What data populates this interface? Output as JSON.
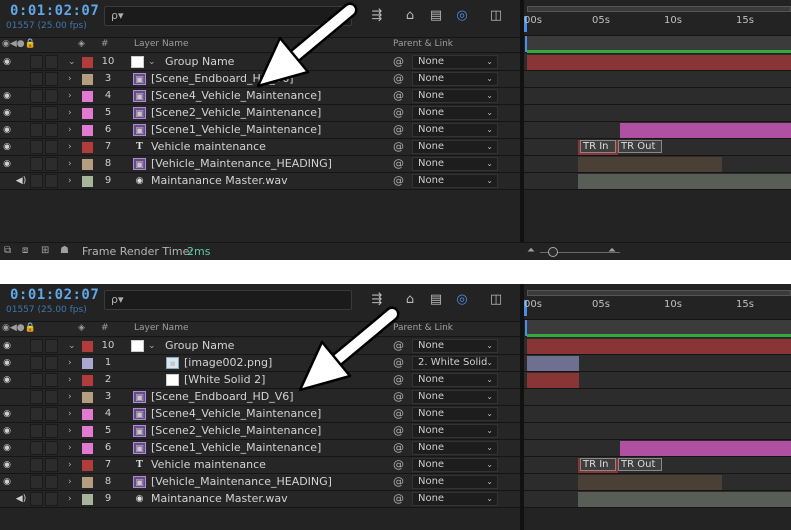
{
  "colors": {
    "accent": "#4a8ee6",
    "timecode": "#5fa7e8",
    "render_time": "#5cc9a7",
    "label_red": "#b03c3c",
    "label_tan": "#b39f7f",
    "label_pink": "#e27ad2",
    "label_sage": "#a7b59b",
    "label_lavender": "#a8a8d2",
    "bar_group": "#8a3535",
    "bar_pink": "#b050a3",
    "bar_purple": "#6f6f8f"
  },
  "panels": [
    {
      "timecode": "0:01:02:07",
      "fps": "01557 (25.00 fps)",
      "search_icon": "ρ▾",
      "header": {
        "layer_name": "Layer Name",
        "parent_link": "Parent & Link",
        "num": "#"
      },
      "ruler": [
        "00s",
        "05s",
        "10s",
        "15s"
      ],
      "layers": [
        {
          "vis": "◉",
          "aud": "",
          "num": "10",
          "label_color": "#b03c3c",
          "icon": "solid",
          "name": "Group Name",
          "twirl": "⌄",
          "parent": "None"
        },
        {
          "vis": "",
          "aud": "",
          "num": "3",
          "label_color": "#b39f7f",
          "icon": "comp",
          "name": "[Scene_Endboard_HD_V6]",
          "twirl": "›",
          "parent": "None"
        },
        {
          "vis": "◉",
          "aud": "",
          "num": "4",
          "label_color": "#e27ad2",
          "icon": "comp",
          "name": "[Scene4_Vehicle_Maintenance]",
          "twirl": "›",
          "parent": "None"
        },
        {
          "vis": "◉",
          "aud": "",
          "num": "5",
          "label_color": "#e27ad2",
          "icon": "comp",
          "name": "[Scene2_Vehicle_Maintenance]",
          "twirl": "›",
          "parent": "None"
        },
        {
          "vis": "◉",
          "aud": "",
          "num": "6",
          "label_color": "#e27ad2",
          "icon": "comp",
          "name": "[Scene1_Vehicle_Maintenance]",
          "twirl": "›",
          "parent": "None"
        },
        {
          "vis": "◉",
          "aud": "",
          "num": "7",
          "label_color": "#b03c3c",
          "icon": "text",
          "name": "Vehicle maintenance",
          "twirl": "›",
          "parent": "None"
        },
        {
          "vis": "◉",
          "aud": "",
          "num": "8",
          "label_color": "#b39f7f",
          "icon": "comp",
          "name": "[Vehicle_Maintenance_HEADING]",
          "twirl": "›",
          "parent": "None"
        },
        {
          "vis": "",
          "aud": "◀)",
          "num": "9",
          "label_color": "#a7b59b",
          "icon": "audio",
          "name": "Maintanance Master.wav",
          "twirl": "›",
          "parent": "None"
        }
      ],
      "markers": {
        "in": "TR In",
        "out": "TR Out"
      },
      "footer": {
        "label": "Frame Render Time:",
        "value": "2ms"
      }
    },
    {
      "timecode": "0:01:02:07",
      "fps": "01557 (25.00 fps)",
      "search_icon": "ρ▾",
      "header": {
        "layer_name": "Layer Name",
        "parent_link": "Parent & Link",
        "num": "#"
      },
      "ruler": [
        "00s",
        "05s",
        "10s",
        "15s"
      ],
      "layers": [
        {
          "vis": "◉",
          "aud": "",
          "num": "10",
          "label_color": "#b03c3c",
          "icon": "solid",
          "name": "Group Name",
          "twirl": "⌄",
          "parent": "None"
        },
        {
          "vis": "◉",
          "aud": "",
          "num": "1",
          "label_color": "#a8a8d2",
          "icon": "png",
          "name": "[image002.png]",
          "twirl": "›",
          "parent": "2. White Solid",
          "indent": true
        },
        {
          "vis": "◉",
          "aud": "",
          "num": "2",
          "label_color": "#b03c3c",
          "icon": "solid",
          "name": "[White Solid 2]",
          "twirl": "›",
          "parent": "None",
          "indent": true
        },
        {
          "vis": "",
          "aud": "",
          "num": "3",
          "label_color": "#b39f7f",
          "icon": "comp",
          "name": "[Scene_Endboard_HD_V6]",
          "twirl": "›",
          "parent": "None"
        },
        {
          "vis": "◉",
          "aud": "",
          "num": "4",
          "label_color": "#e27ad2",
          "icon": "comp",
          "name": "[Scene4_Vehicle_Maintenance]",
          "twirl": "›",
          "parent": "None"
        },
        {
          "vis": "◉",
          "aud": "",
          "num": "5",
          "label_color": "#e27ad2",
          "icon": "comp",
          "name": "[Scene2_Vehicle_Maintenance]",
          "twirl": "›",
          "parent": "None"
        },
        {
          "vis": "◉",
          "aud": "",
          "num": "6",
          "label_color": "#e27ad2",
          "icon": "comp",
          "name": "[Scene1_Vehicle_Maintenance]",
          "twirl": "›",
          "parent": "None"
        },
        {
          "vis": "◉",
          "aud": "",
          "num": "7",
          "label_color": "#b03c3c",
          "icon": "text",
          "name": "Vehicle maintenance",
          "twirl": "›",
          "parent": "None"
        },
        {
          "vis": "◉",
          "aud": "",
          "num": "8",
          "label_color": "#b39f7f",
          "icon": "comp",
          "name": "[Vehicle_Maintenance_HEADING]",
          "twirl": "›",
          "parent": "None"
        },
        {
          "vis": "",
          "aud": "◀)",
          "num": "9",
          "label_color": "#a7b59b",
          "icon": "audio",
          "name": "Maintanance Master.wav",
          "twirl": "›",
          "parent": "None"
        }
      ],
      "markers": {
        "in": "TR In",
        "out": "TR Out"
      }
    }
  ]
}
